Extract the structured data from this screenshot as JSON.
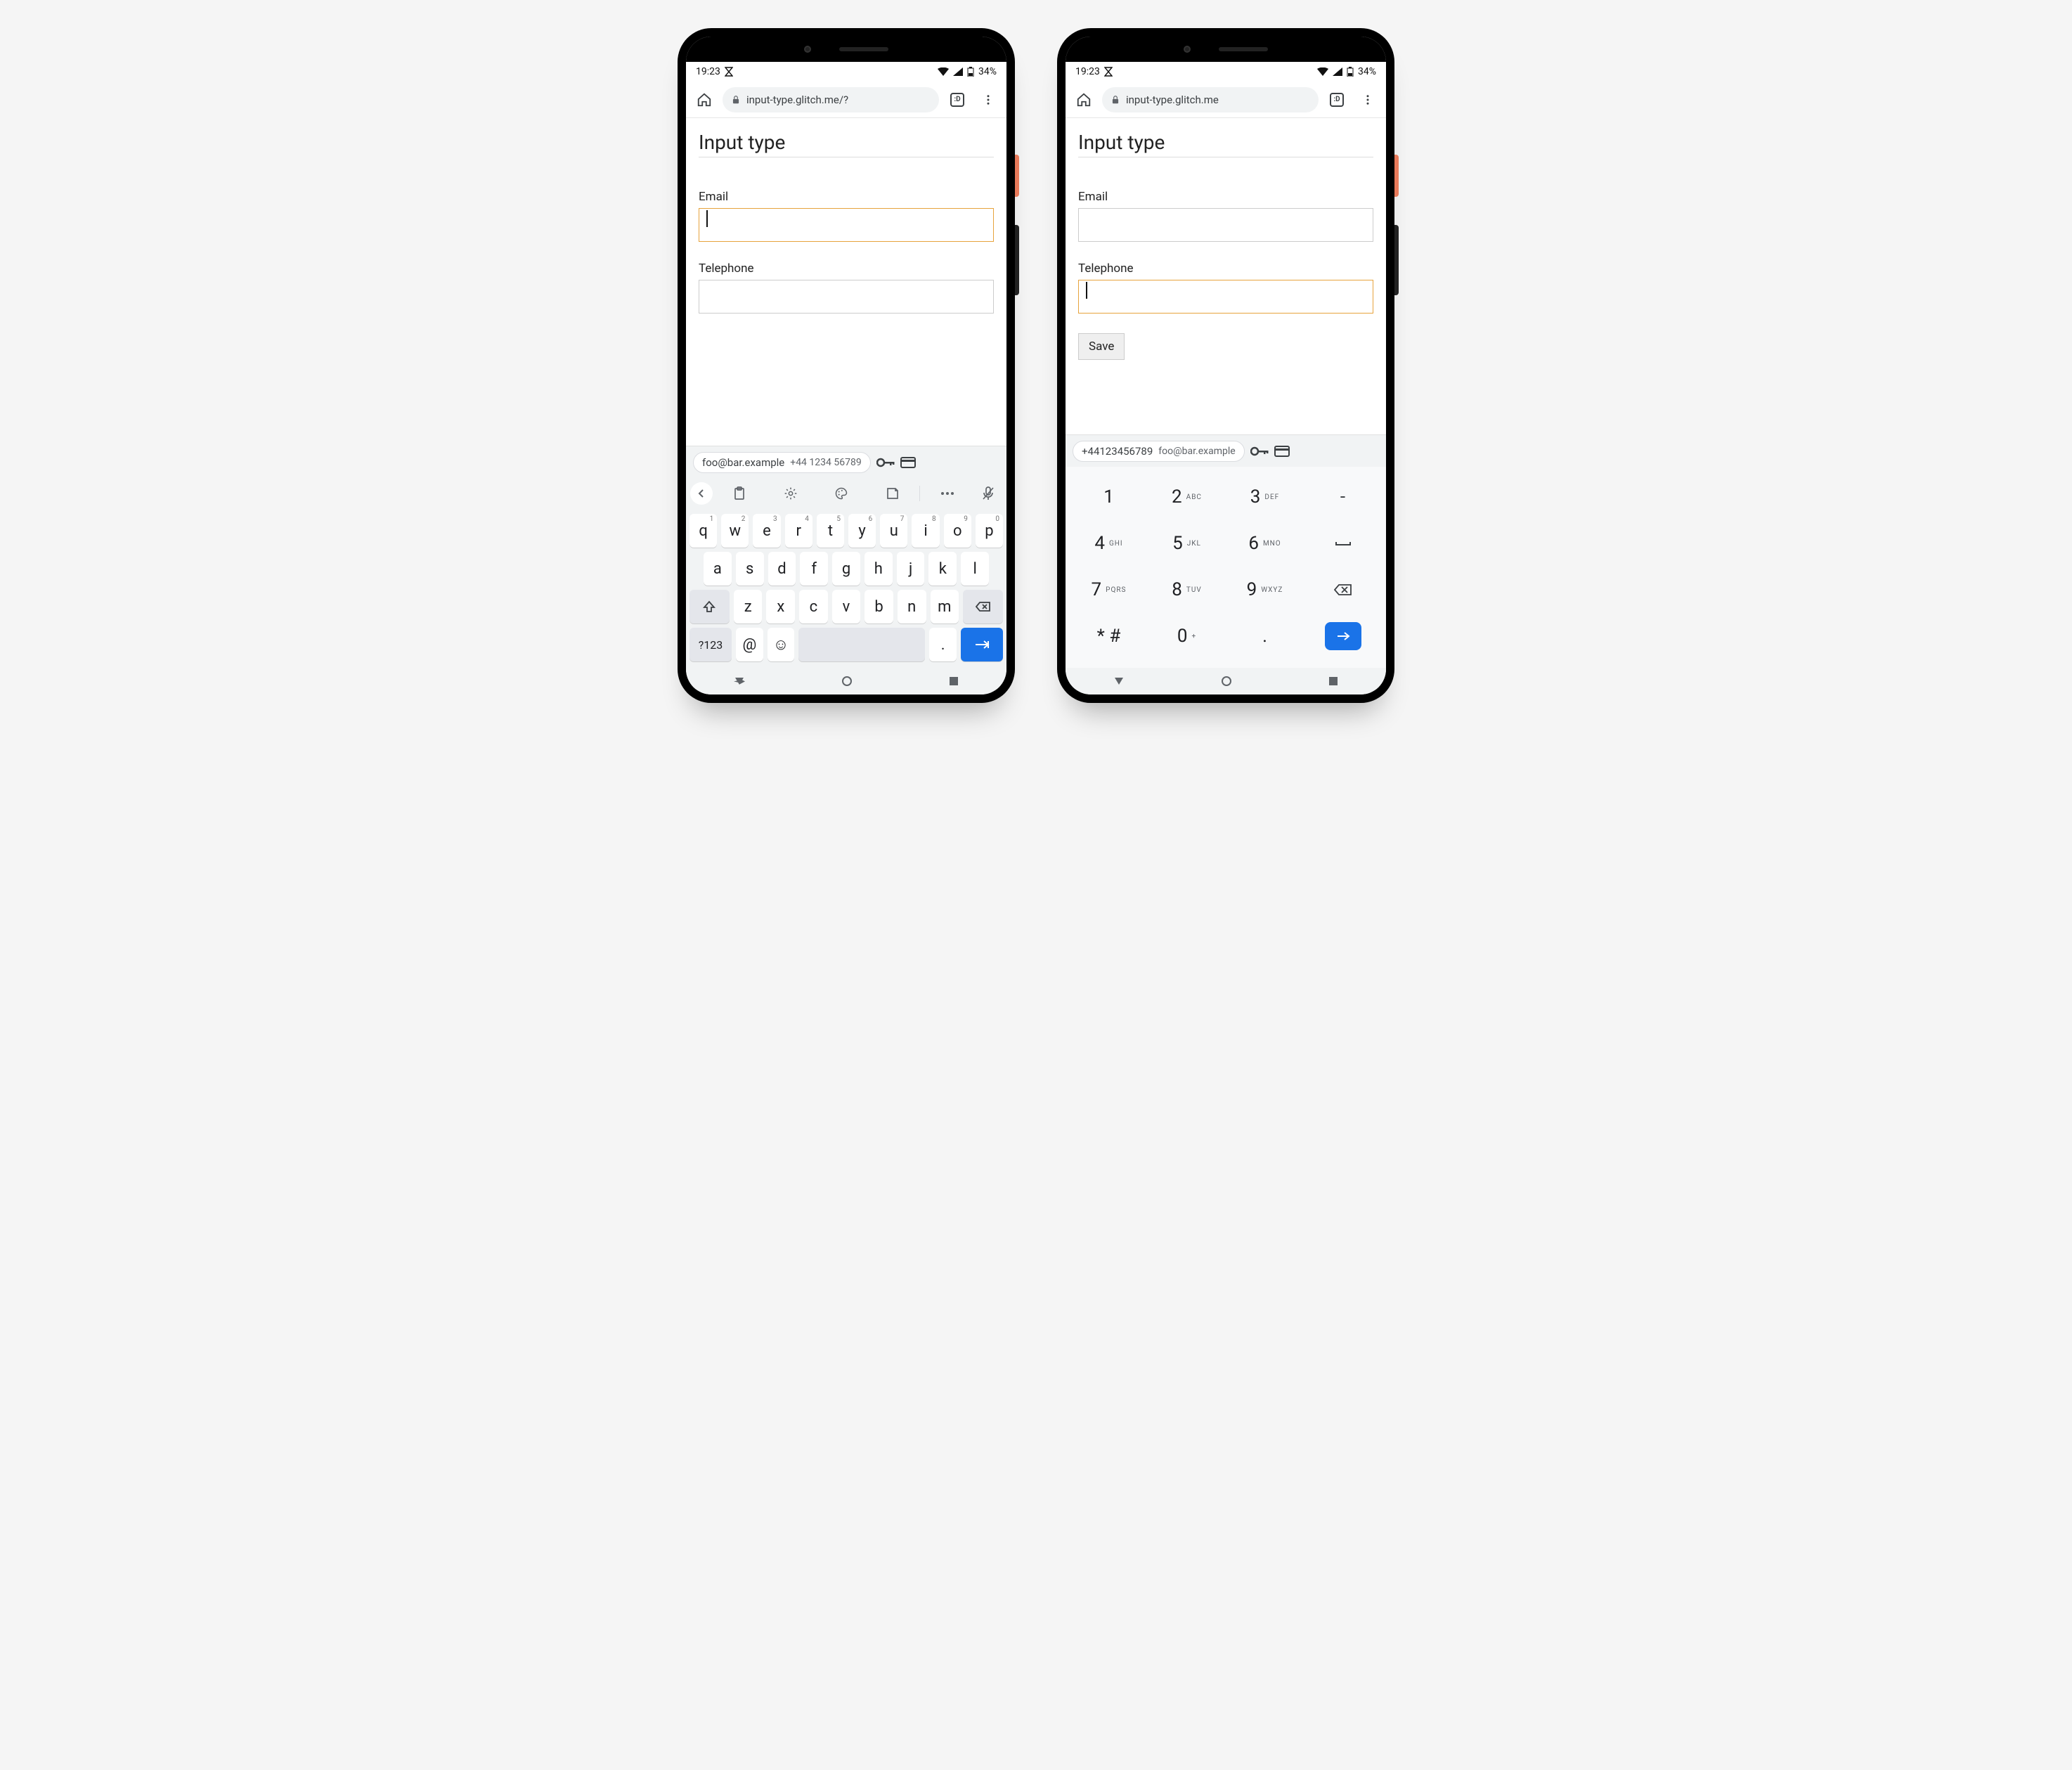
{
  "status": {
    "time": "19:23",
    "battery": "34%"
  },
  "browser": {
    "url_left": "input-type.glitch.me/?",
    "url_right": "input-type.glitch.me",
    "tab_count": ":D"
  },
  "page": {
    "title": "Input type",
    "email_label": "Email",
    "tel_label": "Telephone",
    "save_label": "Save"
  },
  "suggestions": {
    "email": "foo@bar.example",
    "tel": "+44 1234 56789",
    "tel_compact": "+44123456789"
  },
  "qwerty": {
    "row1": [
      {
        "k": "q",
        "s": "1"
      },
      {
        "k": "w",
        "s": "2"
      },
      {
        "k": "e",
        "s": "3"
      },
      {
        "k": "r",
        "s": "4"
      },
      {
        "k": "t",
        "s": "5"
      },
      {
        "k": "y",
        "s": "6"
      },
      {
        "k": "u",
        "s": "7"
      },
      {
        "k": "i",
        "s": "8"
      },
      {
        "k": "o",
        "s": "9"
      },
      {
        "k": "p",
        "s": "0"
      }
    ],
    "row2": [
      "a",
      "s",
      "d",
      "f",
      "g",
      "h",
      "j",
      "k",
      "l"
    ],
    "row3": [
      "z",
      "x",
      "c",
      "v",
      "b",
      "n",
      "m"
    ],
    "sym": "?123",
    "at": "@",
    "period": "."
  },
  "numpad": {
    "rows": [
      [
        {
          "k": "1"
        },
        {
          "k": "2",
          "s": "ABC"
        },
        {
          "k": "3",
          "s": "DEF"
        },
        {
          "k": "-",
          "func": true
        }
      ],
      [
        {
          "k": "4",
          "s": "GHI"
        },
        {
          "k": "5",
          "s": "JKL"
        },
        {
          "k": "6",
          "s": "MNO"
        },
        {
          "k": "␣",
          "func": true
        }
      ],
      [
        {
          "k": "7",
          "s": "PQRS"
        },
        {
          "k": "8",
          "s": "TUV"
        },
        {
          "k": "9",
          "s": "WXYZ"
        },
        {
          "k": "⌫",
          "func": true
        }
      ],
      [
        {
          "k": "* #"
        },
        {
          "k": "0",
          "s": "+"
        },
        {
          "k": "."
        },
        {
          "k": "→",
          "enter": true
        }
      ]
    ]
  }
}
